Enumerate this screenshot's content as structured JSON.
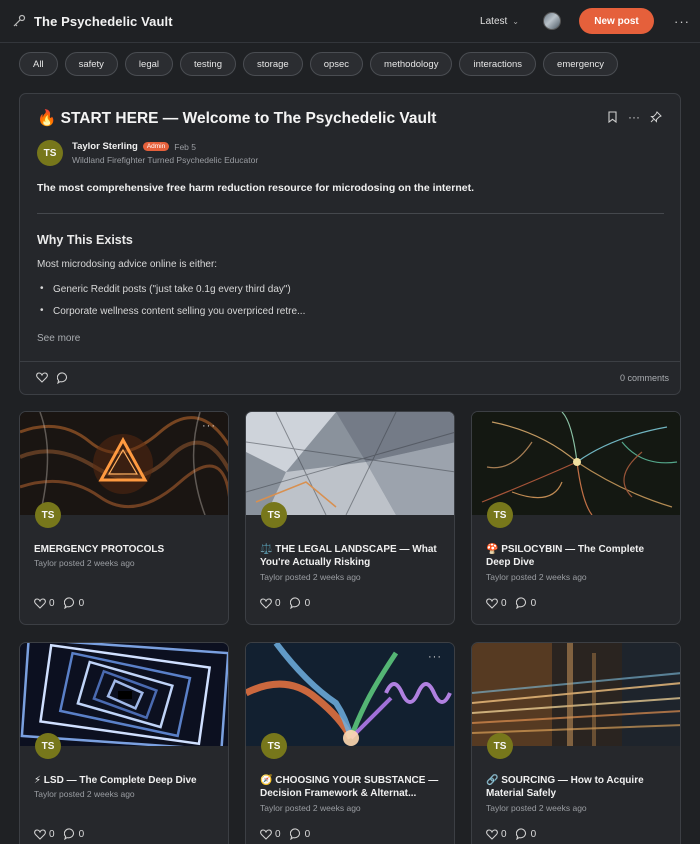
{
  "header": {
    "title": "The Psychedelic Vault",
    "sort_label": "Latest",
    "new_post_label": "New post",
    "more_label": "···"
  },
  "tags": [
    "All",
    "safety",
    "legal",
    "testing",
    "storage",
    "opsec",
    "methodology",
    "interactions",
    "emergency"
  ],
  "featured": {
    "title": "🔥 START HERE — Welcome to The Psychedelic Vault",
    "author_initials": "TS",
    "author_name": "Taylor Sterling",
    "author_badge": "Admin",
    "date": "Feb 5",
    "author_subtitle": "Wildland Firefighter Turned Psychedelic Educator",
    "intro": "The most comprehensive free harm reduction resource for microdosing on the internet.",
    "heading": "Why This Exists",
    "paragraph": "Most microdosing advice online is either:",
    "bullets": [
      "Generic Reddit posts (\"just take 0.1g every third day\")",
      "Corporate wellness content selling you overpriced retre..."
    ],
    "see_more": "See more",
    "comments": "0 comments"
  },
  "cards": [
    {
      "title": "EMERGENCY PROTOCOLS",
      "meta": "Taylor posted 2 weeks ago",
      "initials": "TS",
      "likes": "0",
      "comments": "0"
    },
    {
      "title": "⚖️ THE LEGAL LANDSCAPE — What You're Actually Risking",
      "meta": "Taylor posted 2 weeks ago",
      "initials": "TS",
      "likes": "0",
      "comments": "0"
    },
    {
      "title": "🍄 PSILOCYBIN — The Complete Deep Dive",
      "meta": "Taylor posted 2 weeks ago",
      "initials": "TS",
      "likes": "0",
      "comments": "0"
    },
    {
      "title": "⚡ LSD — The Complete Deep Dive",
      "meta": "Taylor posted 2 weeks ago",
      "initials": "TS",
      "likes": "0",
      "comments": "0"
    },
    {
      "title": "🧭 CHOOSING YOUR SUBSTANCE — Decision Framework & Alternat...",
      "meta": "Taylor posted 2 weeks ago",
      "initials": "TS",
      "likes": "0",
      "comments": "0"
    },
    {
      "title": "🔗 SOURCING — How to Acquire Material Safely",
      "meta": "Taylor posted 2 weeks ago",
      "initials": "TS",
      "likes": "0",
      "comments": "0"
    }
  ]
}
